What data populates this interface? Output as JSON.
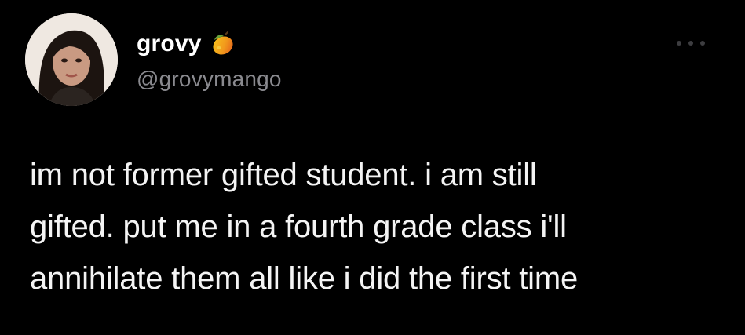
{
  "tweet": {
    "author": {
      "display_name": "grovy",
      "name_emoji_icon": "mango-icon",
      "handle": "@grovymango",
      "avatar_icon": "profile-photo"
    },
    "more_icon": "ellipsis-icon",
    "text_lines": [
      "im not former gifted student. i am still",
      "gifted. put me in a fourth grade class i'll",
      "annihilate them all like i did the first time"
    ]
  },
  "colors": {
    "background": "#000000",
    "text": "#ffffff",
    "handle": "#8a8a8f",
    "more_dots": "#3d3d40"
  }
}
